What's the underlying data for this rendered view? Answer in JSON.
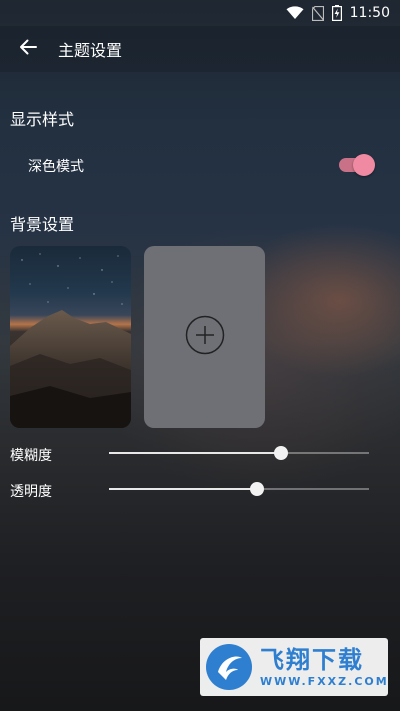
{
  "status_bar": {
    "time": "11:50",
    "icons": [
      "wifi-icon",
      "no-sim-icon",
      "battery-charging-icon"
    ]
  },
  "app_bar": {
    "back_icon": "arrow-left-icon",
    "title": "主题设置"
  },
  "display_style": {
    "heading": "显示样式",
    "dark_mode_label": "深色模式",
    "dark_mode_enabled": true,
    "toggle_color": "#f08aa3"
  },
  "background": {
    "heading": "背景设置",
    "thumbnail": "mountain-night-sky-photo",
    "add_icon": "plus-circle-icon"
  },
  "sliders": {
    "blur_label": "模糊度",
    "blur_value": 0.66,
    "opacity_label": "透明度",
    "opacity_value": 0.57
  },
  "watermark": {
    "main_text": "飞翔下载",
    "sub_text": "WWW.FXXZ.COM",
    "color": "#2f7fd0"
  }
}
